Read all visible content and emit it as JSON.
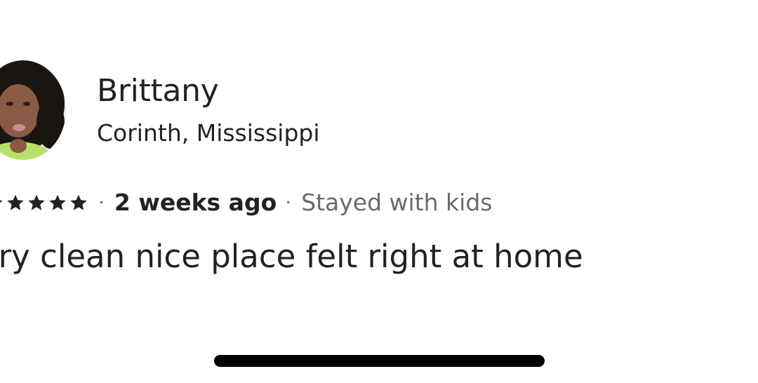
{
  "review": {
    "reviewer_name": "Brittany",
    "reviewer_location": "Corinth, Mississippi",
    "rating": 5,
    "date": "2 weeks ago",
    "separator": "·",
    "trip_type": "Stayed with kids",
    "text": "ery clean nice place felt right at home"
  },
  "icons": {
    "star": "star-icon",
    "avatar": "avatar-photo"
  },
  "colors": {
    "text_primary": "#222222",
    "text_secondary": "#6a6a6a",
    "star": "#222222",
    "home_indicator": "#000000"
  }
}
